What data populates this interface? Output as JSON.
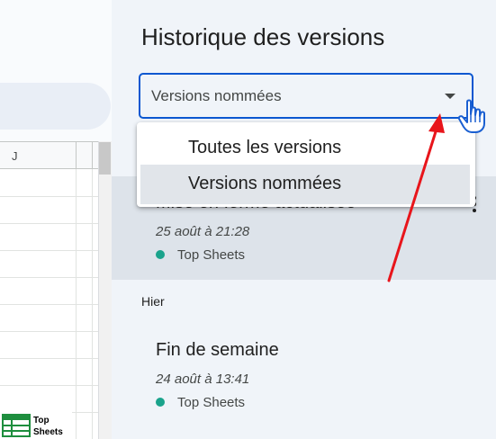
{
  "sheet": {
    "column_label": "J",
    "logo_line1": "Top",
    "logo_line2": "Sheets",
    "logo_icon": "spreadsheet-grid-icon"
  },
  "panel": {
    "title": "Historique des versions",
    "filter_select": {
      "value": "Versions nommées",
      "options": [
        "Toutes les versions",
        "Versions nommées"
      ],
      "selected": "Versions nommées"
    },
    "versions": [
      {
        "title": "Mise en forme actualisée",
        "date": "25 août à 21:28",
        "author": "Top Sheets",
        "author_color": "#1aa38c"
      }
    ],
    "section_label": "Hier",
    "versions_yesterday": [
      {
        "title": "Fin de semaine",
        "date": "24 août à 13:41",
        "author": "Top Sheets",
        "author_color": "#1aa38c"
      }
    ]
  },
  "colors": {
    "accent": "#0b57d0",
    "annotation_arrow": "#e8151b",
    "panel_background": "#f0f4f9",
    "selected_row": "#dde3ea"
  },
  "icons": {
    "caret": "caret-down-icon",
    "more": "more-vert-icon",
    "cursor": "pointer-hand-cursor-icon"
  }
}
